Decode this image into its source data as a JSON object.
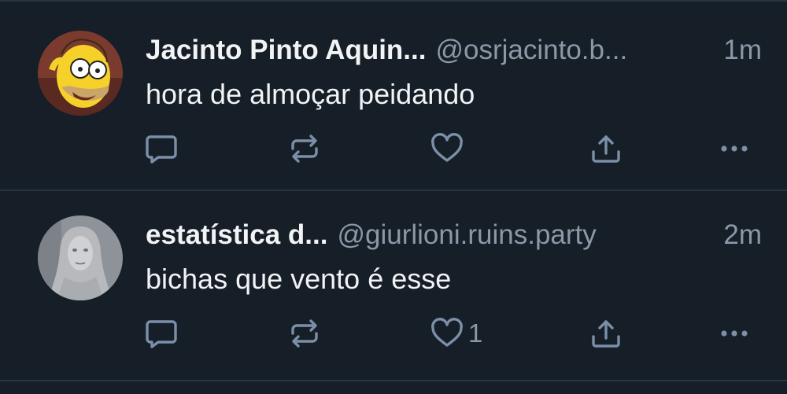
{
  "posts": [
    {
      "display_name": "Jacinto Pinto Aquin...",
      "handle": "@osrjacinto.b...",
      "time": "1m",
      "text": "hora de almoçar peidando",
      "likes": "",
      "avatar_icon": "homer-avatar"
    },
    {
      "display_name": "estatística d...",
      "handle": "@giurlioni.ruins.party",
      "time": "2m",
      "text": "bichas que vento é esse",
      "likes": "1",
      "avatar_icon": "statue-avatar"
    }
  ],
  "colors": {
    "background": "#161e27",
    "divider": "#2a3440",
    "text": "#f1f3f5",
    "muted": "#8a98a8",
    "icon": "#7b8fa8"
  },
  "icons": [
    "reply-icon",
    "repost-icon",
    "like-icon",
    "share-icon",
    "more-icon"
  ]
}
